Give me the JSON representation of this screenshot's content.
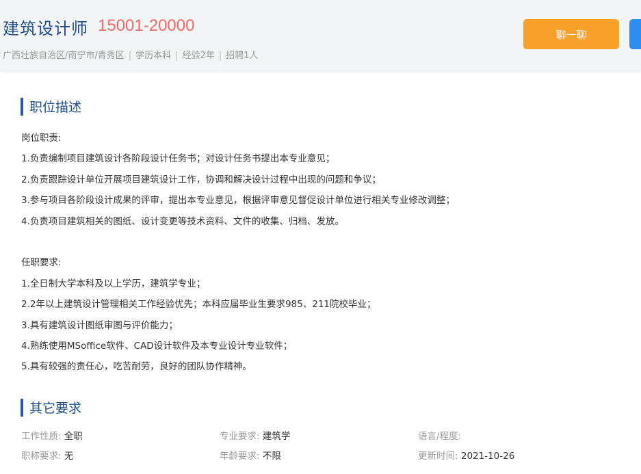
{
  "header": {
    "title": "建筑设计师",
    "salary": "15001-20000",
    "meta": {
      "location": "广西壮族自治区/南宁市/青秀区",
      "education": "学历本科",
      "experience": "经验2年",
      "hiring": "招聘1人",
      "separator": "|"
    },
    "chat_button": "聊一聊"
  },
  "description": {
    "title": "职位描述",
    "duties_heading": "岗位职责:",
    "duties": [
      "1.负责编制项目建筑设计各阶段设计任务书；对设计任务书提出本专业意见；",
      "2.负责跟踪设计单位开展项目建筑设计工作，协调和解决设计过程中出现的问题和争议；",
      "3.参与项目各阶段设计成果的评审，提出本专业意见，根据评审意见督促设计单位进行相关专业修改调整；",
      "4.负责项目建筑相关的图纸、设计变更等技术资料、文件的收集、归档、发放。"
    ],
    "requirements_heading": "任职要求:",
    "requirements": [
      "1.全日制大学本科及以上学历，建筑学专业；",
      "2.2年以上建筑设计管理相关工作经验优先；本科应届毕业生要求985、211院校毕业；",
      "3.具有建筑设计图纸审图与评价能力；",
      "4.熟练使用MSoffice软件、CAD设计软件及本专业设计专业软件；",
      "5.具有较强的责任心，吃苦耐劳，良好的团队协作精神。"
    ]
  },
  "other": {
    "title": "其它要求",
    "rows": [
      [
        {
          "label": "工作性质:",
          "value": "全职"
        },
        {
          "label": "专业要求:",
          "value": "建筑学"
        },
        {
          "label": "语言/程度:",
          "value": ""
        }
      ],
      [
        {
          "label": "职称要求:",
          "value": "无"
        },
        {
          "label": "年龄要求:",
          "value": "不限"
        },
        {
          "label": "更新时间:",
          "value": "2021-10-26"
        }
      ]
    ]
  },
  "colors": {
    "accent": "#1f4e8c",
    "salary": "#f06a6a",
    "chat_button": "#f7a02a",
    "apply_button": "#2f8ff0"
  }
}
